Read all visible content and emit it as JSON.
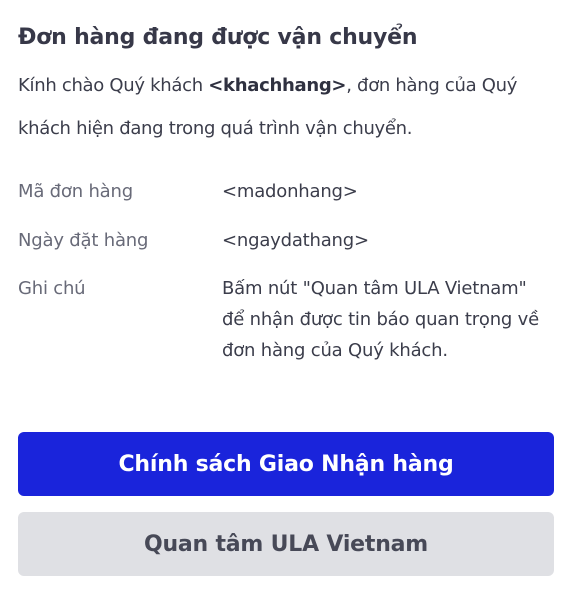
{
  "card": {
    "title": "Đơn hàng đang được vận chuyển",
    "intro_prefix": "Kính chào Quý khách ",
    "intro_customer": "<khachhang>",
    "intro_suffix": ", đơn hàng của Quý khách hiện đang trong quá trình vận chuyển.",
    "details": [
      {
        "label": "Mã đơn hàng",
        "value": "<madonhang>"
      },
      {
        "label": "Ngày đặt hàng",
        "value": "<ngaydathang>"
      },
      {
        "label": "Ghi chú",
        "value": "Bấm nút \"Quan tâm ULA Vietnam\" để nhận được tin báo quan trọng về đơn hàng của Quý khách."
      }
    ],
    "primary_button": "Chính sách Giao Nhận hàng",
    "secondary_button": "Quan tâm ULA Vietnam"
  },
  "colors": {
    "primary_button_bg": "#1a24db",
    "secondary_button_bg": "#dfe0e4",
    "title_text": "#373848",
    "label_text": "#686a78"
  }
}
